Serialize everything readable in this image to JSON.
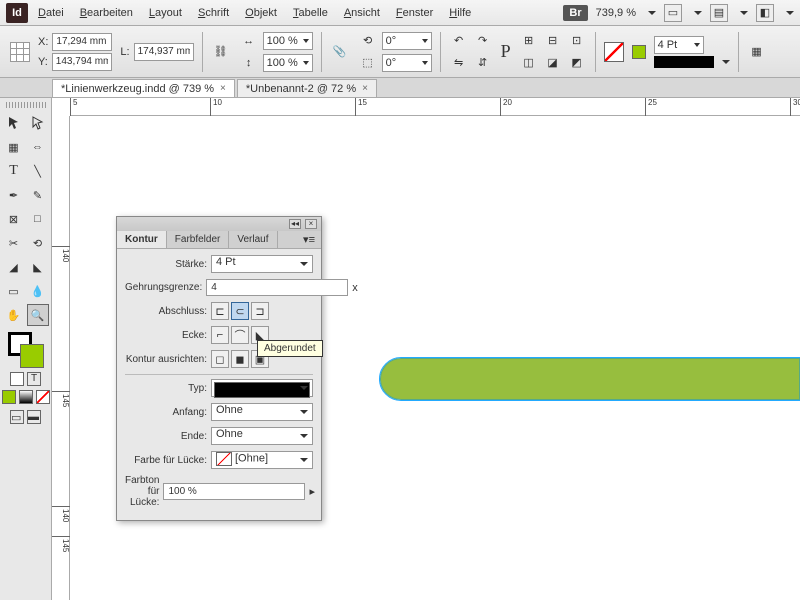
{
  "menubar": {
    "items": [
      "Datei",
      "Bearbeiten",
      "Layout",
      "Schrift",
      "Objekt",
      "Tabelle",
      "Ansicht",
      "Fenster",
      "Hilfe"
    ],
    "br": "Br",
    "zoom": "739,9 %"
  },
  "control": {
    "x_label": "X:",
    "x": "17,294 mm",
    "y_label": "Y:",
    "y": "143,794 mm",
    "l_label": "L:",
    "l": "174,937 mm",
    "scale1": "100 %",
    "scale2": "100 %",
    "rot1": "0°",
    "rot2": "0°",
    "stroke_weight": "4 Pt"
  },
  "tabs": [
    {
      "label": "*Linienwerkzeug.indd @ 739 %",
      "active": true
    },
    {
      "label": "*Unbenannt-2 @ 72 %",
      "active": false
    }
  ],
  "ruler_h": [
    "5",
    "10",
    "15",
    "20",
    "25",
    "30"
  ],
  "ruler_v": [
    "140",
    "145",
    "140",
    "145"
  ],
  "panel": {
    "tabs": [
      "Kontur",
      "Farbfelder",
      "Verlauf"
    ],
    "staerke_label": "Stärke:",
    "staerke": "4 Pt",
    "gehrung_label": "Gehrungsgrenze:",
    "gehrung": "4",
    "gehrung_suffix": "x",
    "abschluss_label": "Abschluss:",
    "ecke_label": "Ecke:",
    "tooltip": "Abgerundet",
    "ausrichten_label": "Kontur ausrichten:",
    "typ_label": "Typ:",
    "anfang_label": "Anfang:",
    "anfang": "Ohne",
    "ende_label": "Ende:",
    "ende": "Ohne",
    "luecke_farbe_label": "Farbe für Lücke:",
    "luecke_farbe": "[Ohne]",
    "luecke_ton_label": "Farbton für Lücke:",
    "luecke_ton": "100 %"
  }
}
